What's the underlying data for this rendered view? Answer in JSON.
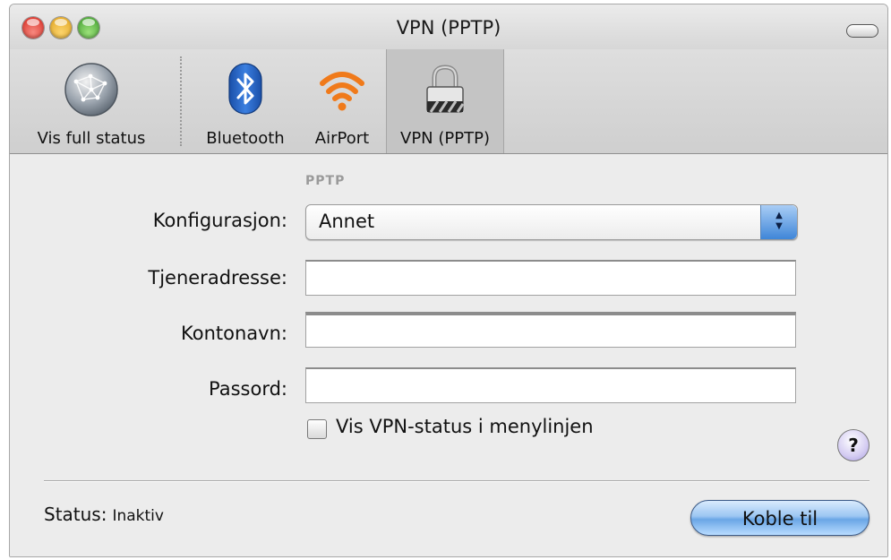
{
  "window": {
    "title": "VPN (PPTP)"
  },
  "toolbar": {
    "items": [
      {
        "label": "Vis full status",
        "icon": "network-globe-icon"
      },
      {
        "label": "Bluetooth",
        "icon": "bluetooth-icon"
      },
      {
        "label": "AirPort",
        "icon": "airport-wifi-icon"
      },
      {
        "label": "VPN (PPTP)",
        "icon": "vpn-lock-icon",
        "selected": true
      }
    ]
  },
  "form": {
    "section_label": "PPTP",
    "configuration_label": "Konfigurasjon:",
    "configuration_value": "Annet",
    "server_label": "Tjeneradresse:",
    "server_value": "",
    "account_label": "Kontonavn:",
    "account_value": "",
    "password_label": "Passord:",
    "password_value": "",
    "show_status_label": "Vis VPN-status i menylinjen",
    "show_status_checked": false
  },
  "help": {
    "label": "?"
  },
  "footer": {
    "status_label": "Status:",
    "status_value": "Inaktiv",
    "connect_label": "Koble til"
  },
  "colors": {
    "accent": "#6aa6e6",
    "window_bg": "#ececec"
  }
}
